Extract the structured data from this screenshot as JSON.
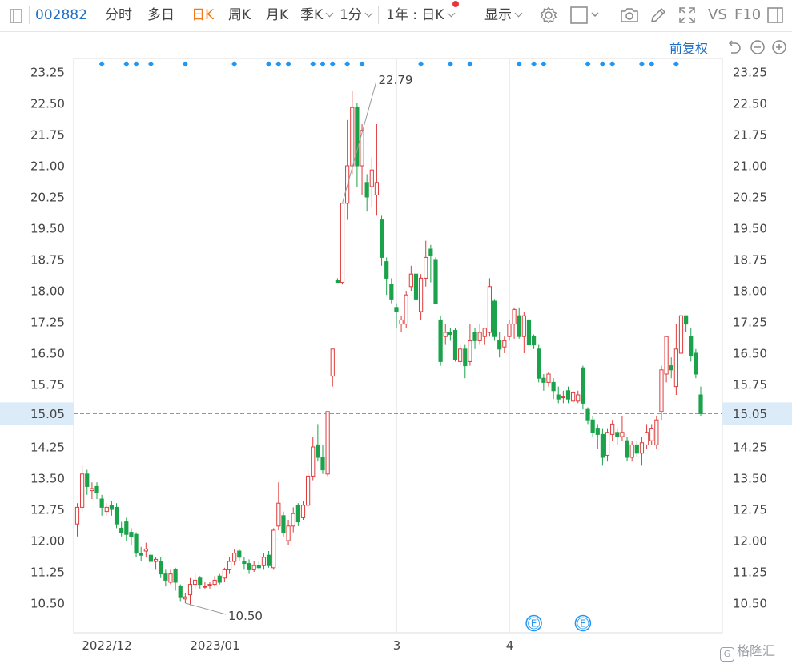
{
  "toolbar": {
    "stock_code": "002882",
    "periods": [
      "分时",
      "多日",
      "日K",
      "周K",
      "月K"
    ],
    "active_period": "日K",
    "season": "季K",
    "minute": "1分",
    "range": "1年 : 日K",
    "display": "显示",
    "vs": "VS",
    "f10": "F10"
  },
  "adjust_label": "前复权",
  "icons": [
    "settings-icon",
    "box-select-icon",
    "camera-icon",
    "pen-icon",
    "fullscreen-icon",
    "panel-icon",
    "undo-icon",
    "zoom-out-icon",
    "zoom-in-icon"
  ],
  "colors": {
    "up": "#e03b3b",
    "down": "#1aa34a",
    "accent": "#1f6fc5",
    "current_line": "#e8832b",
    "marker": "#2196f3"
  },
  "watermark": "格隆汇",
  "chart_data": {
    "type": "candlestick",
    "ylim": [
      10.2,
      23.6
    ],
    "yticks": [
      "23.25",
      "22.50",
      "21.75",
      "21.00",
      "20.25",
      "19.50",
      "18.75",
      "18.00",
      "17.25",
      "16.50",
      "15.75",
      "15.05",
      "14.25",
      "13.50",
      "12.75",
      "12.00",
      "11.25",
      "10.50"
    ],
    "x_labels": [
      "2022/12",
      "2023/01",
      "3",
      "4"
    ],
    "x_label_index": [
      6,
      28,
      65,
      88
    ],
    "current_price": 15.05,
    "high_label": "22.79",
    "high_index": 54,
    "low_label": "10.50",
    "low_index": 22,
    "event_markers": [
      "E",
      "E"
    ],
    "event_index": [
      93,
      103
    ],
    "dot_index": [
      5,
      10,
      12,
      15,
      22,
      32,
      39,
      41,
      43,
      48,
      50,
      52,
      55,
      58,
      70,
      76,
      80,
      90,
      93,
      95,
      104,
      107,
      109,
      115,
      117,
      122
    ],
    "candles": [
      [
        12.4,
        12.8,
        12.9,
        12.1
      ],
      [
        12.8,
        13.6,
        13.8,
        12.7
      ],
      [
        13.6,
        13.3,
        13.7,
        13.1
      ],
      [
        13.2,
        13.25,
        13.4,
        13.0
      ],
      [
        13.3,
        13.15,
        13.4,
        13.0
      ],
      [
        13.0,
        12.8,
        13.1,
        12.6
      ],
      [
        12.7,
        12.8,
        12.9,
        12.6
      ],
      [
        12.85,
        12.75,
        12.95,
        12.6
      ],
      [
        12.8,
        12.4,
        12.9,
        12.3
      ],
      [
        12.3,
        12.2,
        12.45,
        12.1
      ],
      [
        12.45,
        12.15,
        12.55,
        12.0
      ],
      [
        12.2,
        12.1,
        12.3,
        11.9
      ],
      [
        12.15,
        11.7,
        12.2,
        11.6
      ],
      [
        11.7,
        11.65,
        11.85,
        11.5
      ],
      [
        11.75,
        11.8,
        11.95,
        11.6
      ],
      [
        11.65,
        11.5,
        11.75,
        11.4
      ],
      [
        11.5,
        11.55,
        11.6,
        11.3
      ],
      [
        11.5,
        11.2,
        11.6,
        11.1
      ],
      [
        11.2,
        11.05,
        11.3,
        10.9
      ],
      [
        11.0,
        11.2,
        11.3,
        10.95
      ],
      [
        11.3,
        11.0,
        11.35,
        10.8
      ],
      [
        10.9,
        10.65,
        10.95,
        10.55
      ],
      [
        10.6,
        10.65,
        10.75,
        10.5
      ],
      [
        10.7,
        10.95,
        11.1,
        10.45
      ],
      [
        10.95,
        11.05,
        11.2,
        10.85
      ],
      [
        11.1,
        10.95,
        11.15,
        10.85
      ],
      [
        10.9,
        10.9,
        11.0,
        10.85
      ],
      [
        10.95,
        10.95,
        11.0,
        10.85
      ],
      [
        10.95,
        11.05,
        11.15,
        10.9
      ],
      [
        11.15,
        11.0,
        11.2,
        10.95
      ],
      [
        11.1,
        11.3,
        11.35,
        11.0
      ],
      [
        11.3,
        11.5,
        11.6,
        11.2
      ],
      [
        11.5,
        11.7,
        11.8,
        11.4
      ],
      [
        11.75,
        11.6,
        11.8,
        11.5
      ],
      [
        11.5,
        11.45,
        11.6,
        11.3
      ],
      [
        11.45,
        11.3,
        11.55,
        11.2
      ],
      [
        11.3,
        11.4,
        11.5,
        11.25
      ],
      [
        11.4,
        11.35,
        11.5,
        11.3
      ],
      [
        11.4,
        11.6,
        11.7,
        11.3
      ],
      [
        11.65,
        11.4,
        11.75,
        11.35
      ],
      [
        11.35,
        12.25,
        12.3,
        11.3
      ],
      [
        12.35,
        12.9,
        13.4,
        12.25
      ],
      [
        12.6,
        12.2,
        12.7,
        12.1
      ],
      [
        12.0,
        12.35,
        12.5,
        11.9
      ],
      [
        12.35,
        12.65,
        12.8,
        12.2
      ],
      [
        12.85,
        12.45,
        12.9,
        12.35
      ],
      [
        12.55,
        12.85,
        12.95,
        12.5
      ],
      [
        12.85,
        13.55,
        13.7,
        12.75
      ],
      [
        13.55,
        14.25,
        14.5,
        13.45
      ],
      [
        14.3,
        14.0,
        14.8,
        13.9
      ],
      [
        14.0,
        13.7,
        14.3,
        13.6
      ],
      [
        13.6,
        15.1,
        15.1,
        13.55
      ],
      [
        15.95,
        16.6,
        16.6,
        15.7
      ],
      [
        18.25,
        18.2,
        18.3,
        18.2
      ],
      [
        18.2,
        20.1,
        20.1,
        18.15
      ],
      [
        20.1,
        21.0,
        22.1,
        19.7
      ],
      [
        21.0,
        22.4,
        22.79,
        20.8
      ],
      [
        22.4,
        21.0,
        22.5,
        20.5
      ],
      [
        21.0,
        21.85,
        22.0,
        20.3
      ],
      [
        20.6,
        20.25,
        20.8,
        19.9
      ],
      [
        20.5,
        20.9,
        21.2,
        20.0
      ],
      [
        20.3,
        20.6,
        22.0,
        19.8
      ],
      [
        19.7,
        18.8,
        19.8,
        18.6
      ],
      [
        18.7,
        18.3,
        18.8,
        17.9
      ],
      [
        18.15,
        17.8,
        18.3,
        17.7
      ],
      [
        17.6,
        17.5,
        17.7,
        17.1
      ],
      [
        17.2,
        17.3,
        17.4,
        17.0
      ],
      [
        17.2,
        17.9,
        18.0,
        17.1
      ],
      [
        18.1,
        18.4,
        18.6,
        18.0
      ],
      [
        18.4,
        17.8,
        18.7,
        17.7
      ],
      [
        17.5,
        18.3,
        18.4,
        17.3
      ],
      [
        18.3,
        18.8,
        19.2,
        18.1
      ],
      [
        19.0,
        18.85,
        19.1,
        18.2
      ],
      [
        18.75,
        17.7,
        18.8,
        17.7
      ],
      [
        17.3,
        16.3,
        17.4,
        16.2
      ],
      [
        16.9,
        17.0,
        17.2,
        16.7
      ],
      [
        17.0,
        16.95,
        17.1,
        16.8
      ],
      [
        17.05,
        16.35,
        17.1,
        16.3
      ],
      [
        16.3,
        16.6,
        16.7,
        16.2
      ],
      [
        16.6,
        16.2,
        16.7,
        15.9
      ],
      [
        16.3,
        16.8,
        17.2,
        16.2
      ],
      [
        17.0,
        16.8,
        17.1,
        16.6
      ],
      [
        16.8,
        17.0,
        17.2,
        16.7
      ],
      [
        16.9,
        17.1,
        17.1,
        16.7
      ],
      [
        17.0,
        18.1,
        18.3,
        16.9
      ],
      [
        17.75,
        16.9,
        17.8,
        16.8
      ],
      [
        16.8,
        16.6,
        17.0,
        16.4
      ],
      [
        16.65,
        16.8,
        16.9,
        16.5
      ],
      [
        16.9,
        17.2,
        17.3,
        16.8
      ],
      [
        17.2,
        17.55,
        17.6,
        16.85
      ],
      [
        17.4,
        16.9,
        17.6,
        16.85
      ],
      [
        16.9,
        17.4,
        17.5,
        16.5
      ],
      [
        17.3,
        16.7,
        17.35,
        16.5
      ],
      [
        16.9,
        16.7,
        16.95,
        16.6
      ],
      [
        16.6,
        15.9,
        16.7,
        15.8
      ],
      [
        15.9,
        15.8,
        16.0,
        15.6
      ],
      [
        15.8,
        16.0,
        16.05,
        15.7
      ],
      [
        15.8,
        15.6,
        15.9,
        15.4
      ],
      [
        15.5,
        15.4,
        15.7,
        15.3
      ],
      [
        15.45,
        15.45,
        15.6,
        15.3
      ],
      [
        15.6,
        15.4,
        15.7,
        15.3
      ],
      [
        15.35,
        15.55,
        15.6,
        15.3
      ],
      [
        15.35,
        15.5,
        15.6,
        15.3
      ],
      [
        16.15,
        15.3,
        16.2,
        15.15
      ],
      [
        15.15,
        14.9,
        15.2,
        14.8
      ],
      [
        14.9,
        14.6,
        15.0,
        14.5
      ],
      [
        14.7,
        14.55,
        14.8,
        14.2
      ],
      [
        14.55,
        14.0,
        14.7,
        13.8
      ],
      [
        14.05,
        14.6,
        14.7,
        13.9
      ],
      [
        14.55,
        14.8,
        14.9,
        14.4
      ],
      [
        14.6,
        14.5,
        14.7,
        14.3
      ],
      [
        14.5,
        14.6,
        15.0,
        14.4
      ],
      [
        14.4,
        14.0,
        14.5,
        13.9
      ],
      [
        14.0,
        14.3,
        14.4,
        13.9
      ],
      [
        14.3,
        14.1,
        14.4,
        14.0
      ],
      [
        14.1,
        14.35,
        14.5,
        13.8
      ],
      [
        14.3,
        14.6,
        14.8,
        14.2
      ],
      [
        14.4,
        14.7,
        14.8,
        14.3
      ],
      [
        14.3,
        14.9,
        15.0,
        14.2
      ],
      [
        15.1,
        16.1,
        16.2,
        14.9
      ],
      [
        16.0,
        16.9,
        16.9,
        15.8
      ],
      [
        16.2,
        16.1,
        16.4,
        15.9
      ],
      [
        15.7,
        16.6,
        17.2,
        15.5
      ],
      [
        16.5,
        17.4,
        17.9,
        16.4
      ],
      [
        17.4,
        17.2,
        17.4,
        17.0
      ],
      [
        16.9,
        16.45,
        17.1,
        16.3
      ],
      [
        16.5,
        16.0,
        16.6,
        15.9
      ],
      [
        15.5,
        15.05,
        15.7,
        15.0
      ]
    ]
  }
}
